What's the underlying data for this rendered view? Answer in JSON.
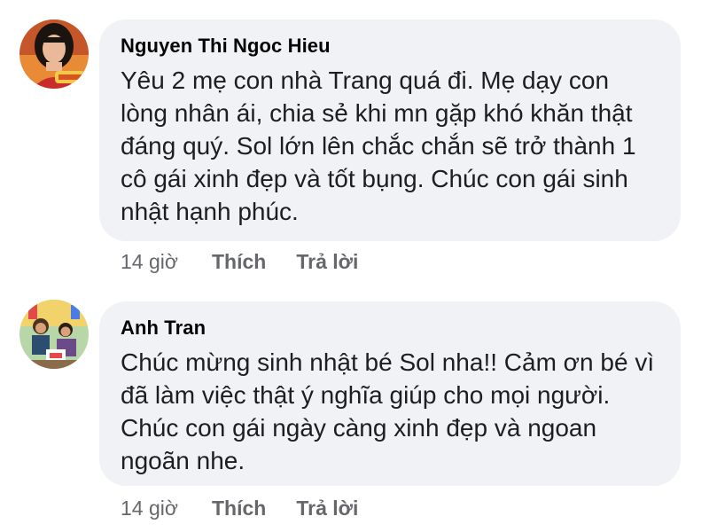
{
  "comments": [
    {
      "author": "Nguyen Thi Ngoc Hieu",
      "text": "Yêu 2 mẹ con nhà Trang quá đi. Mẹ dạy con lòng nhân ái, chia sẻ khi mn gặp khó khăn thật đáng quý. Sol lớn lên chắc chắn sẽ trở thành 1 cô gái xinh đẹp và tốt bụng. Chúc con gái sinh nhật hạnh phúc.",
      "time": "14 giờ",
      "like_label": "Thích",
      "reply_label": "Trả lời",
      "avatar_icon": "woman-portrait-avatar"
    },
    {
      "author": "Anh Tran",
      "text": "Chúc mừng sinh nhật bé Sol nha!! Cảm ơn bé vì đã làm việc thật ý nghĩa giúp cho mọi người. Chúc con gái ngày càng xinh đẹp và ngoan ngoãn nhe.",
      "time": "14 giờ",
      "like_label": "Thích",
      "reply_label": "Trả lời",
      "avatar_icon": "family-photo-avatar"
    }
  ],
  "colors": {
    "bubble": "#f0f2f5",
    "author": "#050505",
    "text": "#1c1e21",
    "meta": "#65676b"
  }
}
